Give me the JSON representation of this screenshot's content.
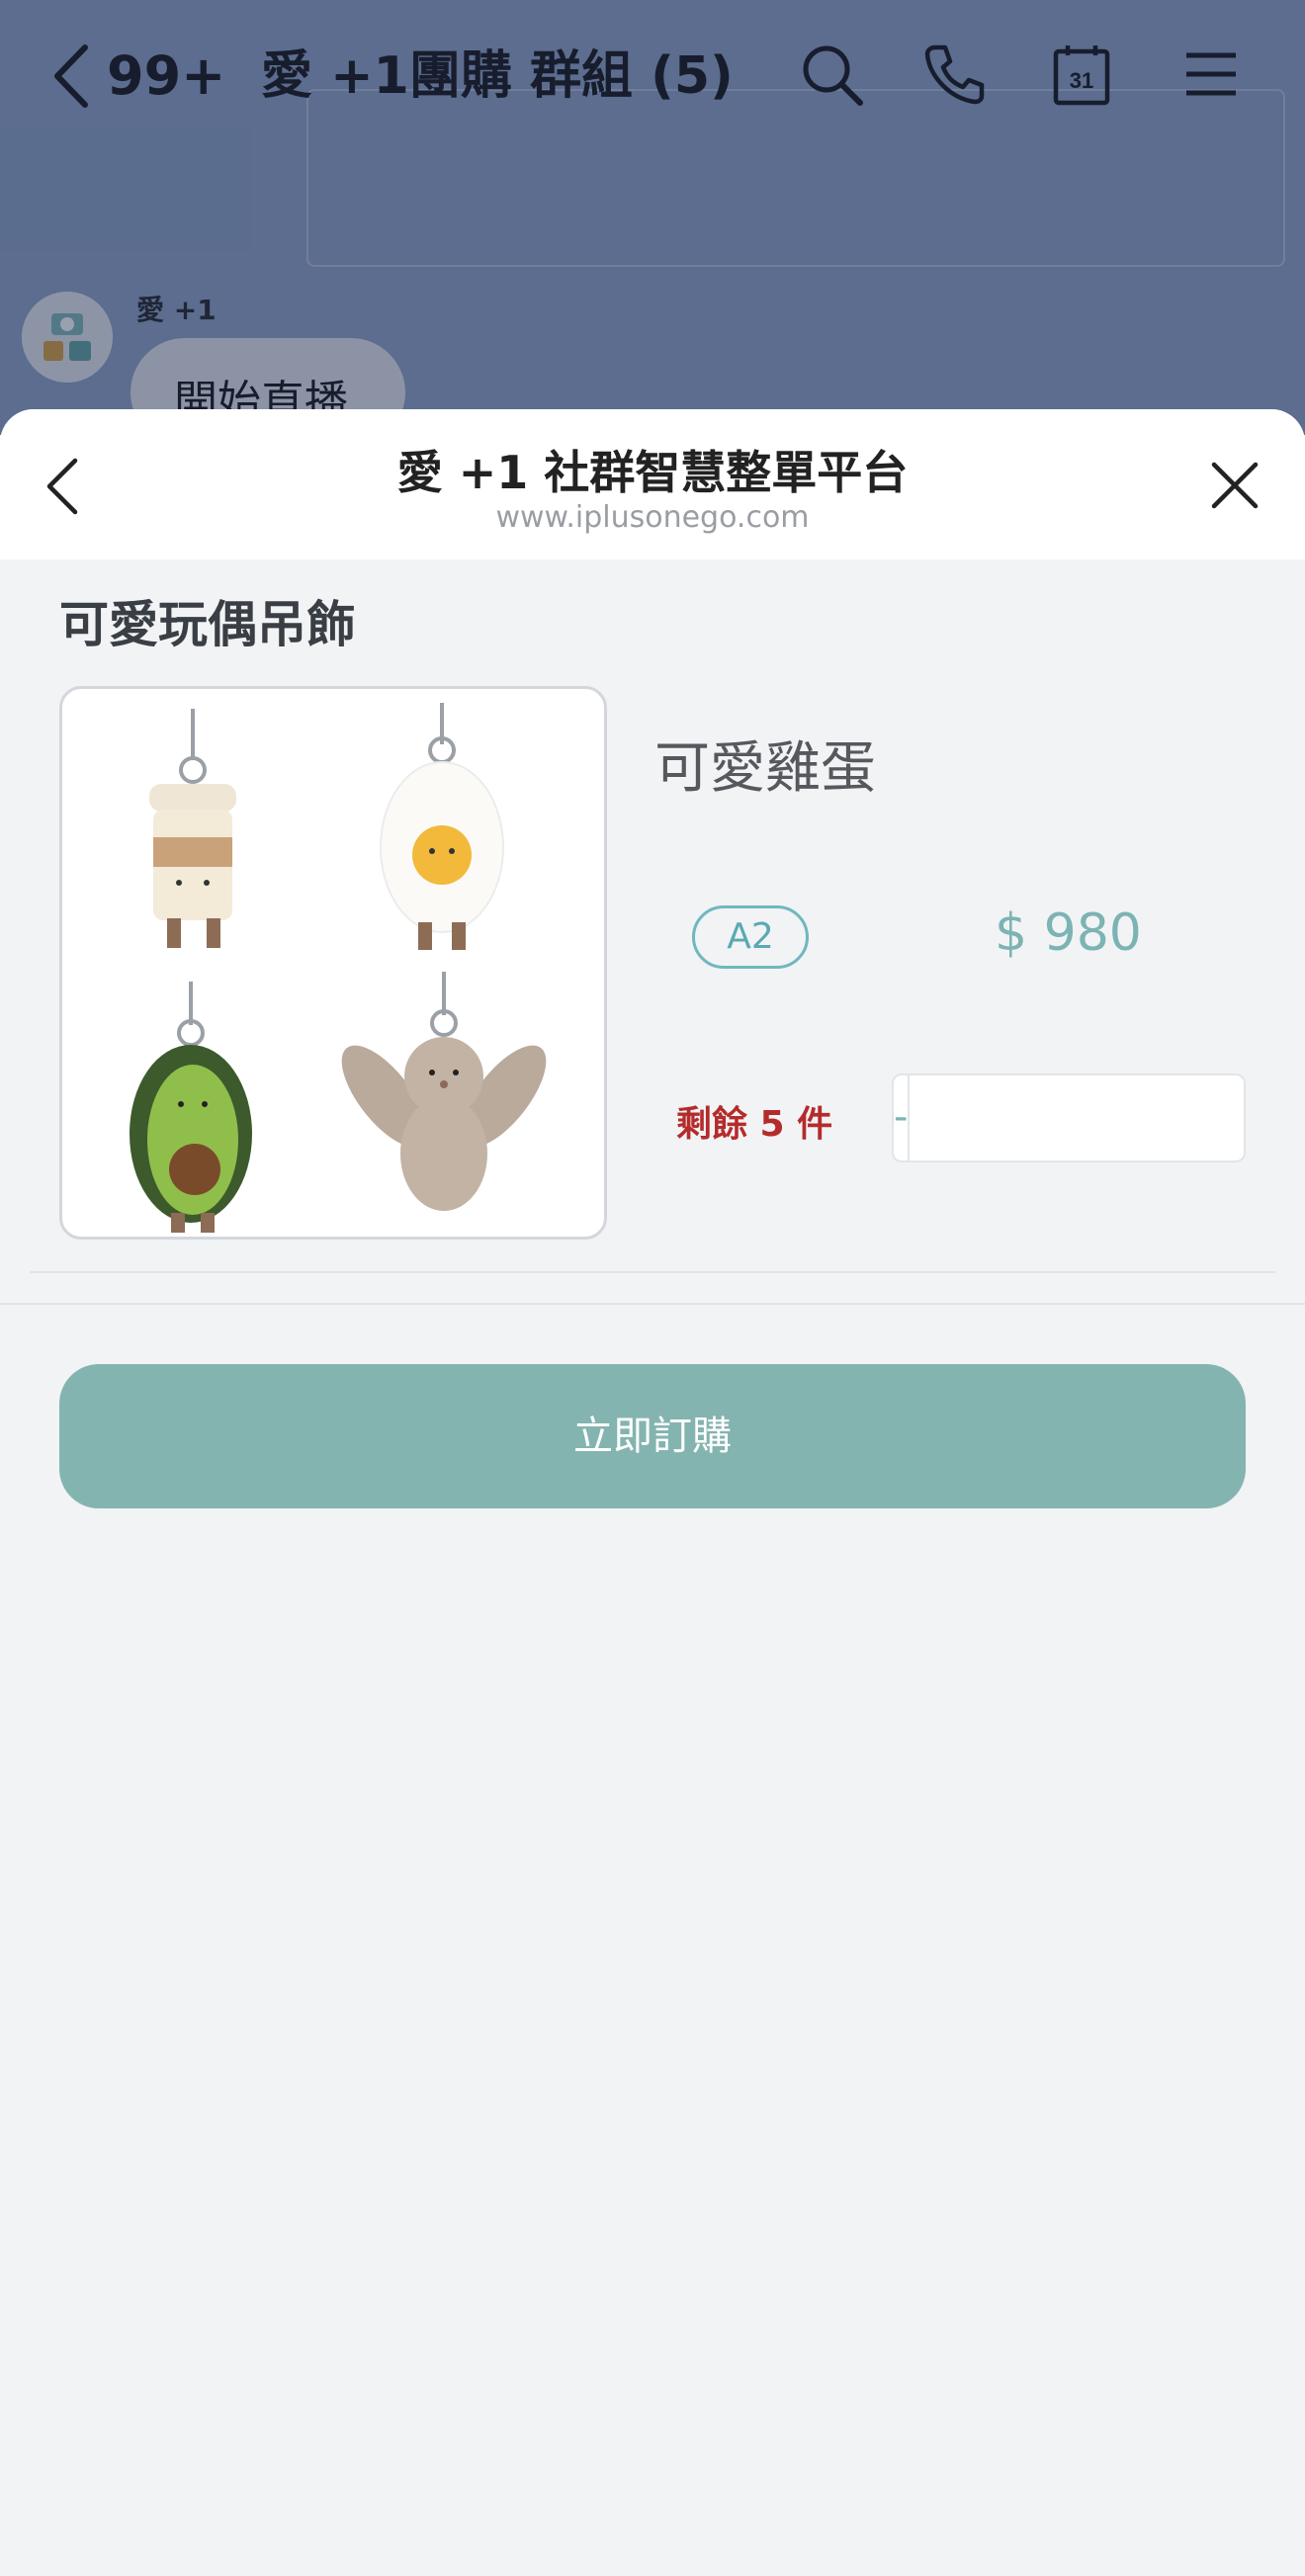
{
  "chat": {
    "back_icon": "chevron-left-icon",
    "unread_count": "99+",
    "group_title": "愛 +1團購 群組 (5)",
    "toolbar_icons": [
      "search-icon",
      "phone-icon",
      "calendar-icon",
      "menu-icon"
    ],
    "calendar_day": "31",
    "message": {
      "sender": "愛 +1",
      "text": "開始直播",
      "avatar": "brand-logo-avatar"
    }
  },
  "sheet": {
    "title": "愛 +1 社群智慧整單平台",
    "url": "www.iplusonego.com",
    "back_icon": "chevron-left-icon",
    "close_icon": "close-icon"
  },
  "product": {
    "title": "可愛玩偶吊飾",
    "image_alt": "plush-keychains",
    "variant_name": "可愛雞蛋",
    "code": "A2",
    "price": "$ 980",
    "stock": "剩餘 5 件",
    "quantity": {
      "minus_label": "-",
      "plus_label": "+",
      "value": ""
    },
    "order_button_label": "立即訂購"
  },
  "colors": {
    "accent": "#84b4b0",
    "badge": "#6fb7bf",
    "price": "#7cb3b3",
    "stock": "#b52b2b",
    "chat_bg": "#8ea2c3"
  }
}
